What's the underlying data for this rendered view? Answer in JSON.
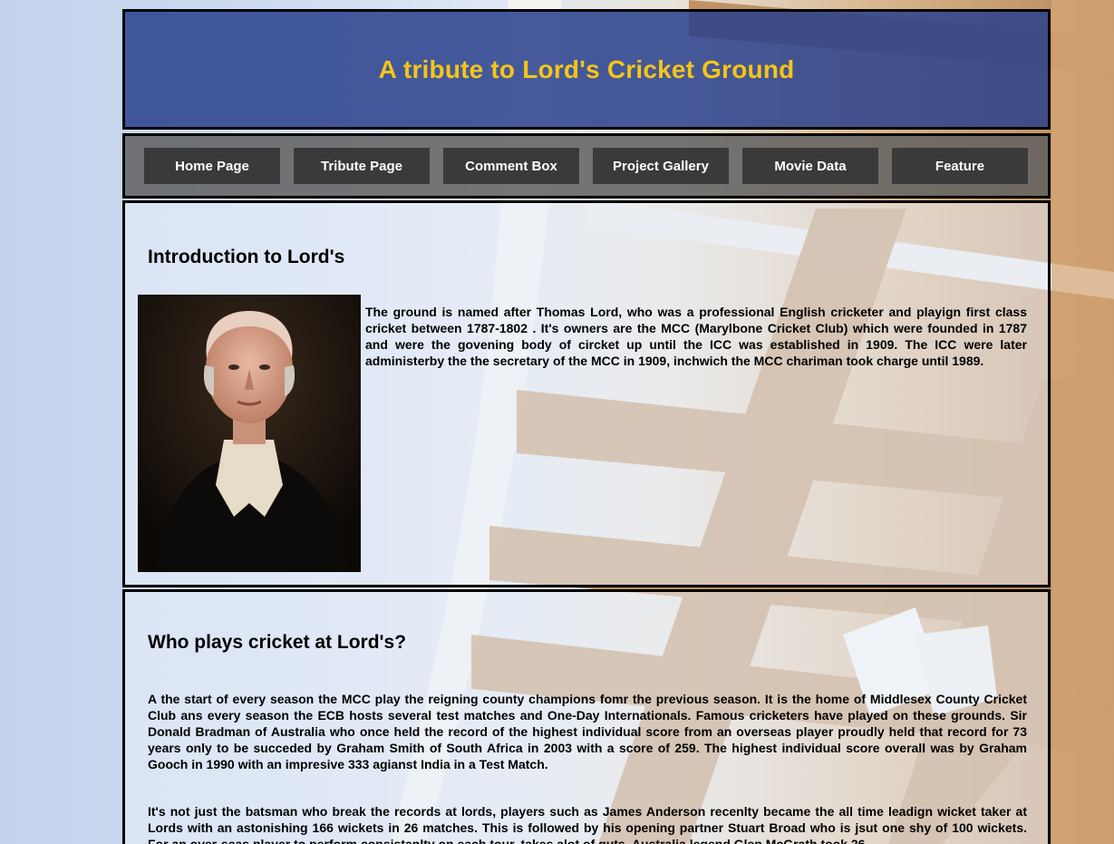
{
  "header": {
    "title": "A tribute to Lord's Cricket Ground"
  },
  "nav": {
    "items": [
      {
        "label": "Home Page"
      },
      {
        "label": "Tribute Page"
      },
      {
        "label": "Comment Box"
      },
      {
        "label": "Project Gallery"
      },
      {
        "label": "Movie Data"
      },
      {
        "label": "Feature"
      }
    ]
  },
  "intro": {
    "heading": "Introduction to Lord's",
    "text": "The ground is named after Thomas Lord, who was a professional English cricketer and playign first class cricket between 1787-1802 . It's owners are the MCC (Marylbone Cricket Club) which were founded in 1787 and were the govening body of circket up until the ICC was established in 1909. The ICC were later administerby the the secretary of the MCC in 1909, inchwich the MCC chariman took charge until 1989."
  },
  "who": {
    "heading": "Who plays cricket at Lord's?",
    "para1": "A the start of every season the MCC play the reigning county champions fomr the previous season. It is the home of Middlesex County Cricket Club ans every season the ECB hosts several test matches and One-Day Internationals. Famous cricketers have played on these grounds. Sir Donald Bradman of Australia who once held the record of the highest individual score from an overseas player proudly held that record for 73 years only to be succeded by Graham Smith of South Africa in 2003 with a score of 259. The highest individual score overall was by Graham Gooch in 1990 with an impresive 333 agianst India in a Test Match.",
    "para2": "It's not just the batsman who break the records at lords, players such as James Anderson recenlty became the all time leadign wicket taker at Lords with an astonishing 166 wickets in 26 matches. This is followed by his opening partner Stuart Broad who is jsut one shy of 100 wickets. For an over-seas player to perform consistanlty on each tour, takes alot of guts. Australia legend Glen McGrath took 26"
  },
  "colors": {
    "header_bg": "#28408c",
    "title": "#f5c518",
    "nav_bg": "#5f5f5f",
    "nav_button": "#3a3a3a"
  }
}
